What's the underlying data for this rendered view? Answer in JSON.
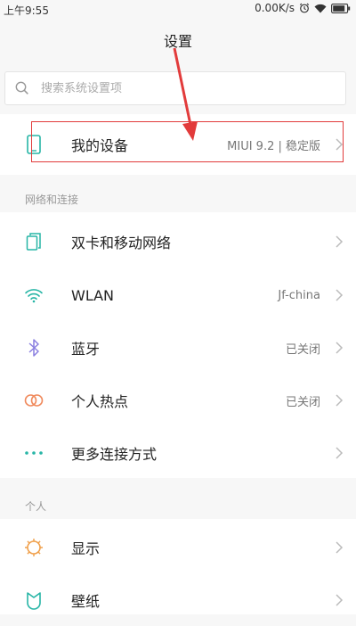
{
  "status": {
    "time": "上午9:55",
    "network_speed": "0.00K/s",
    "icons": [
      "alarm-icon",
      "wifi-icon",
      "battery-icon"
    ]
  },
  "header": {
    "title": "设置"
  },
  "search": {
    "placeholder": "搜索系统设置项"
  },
  "device": {
    "label": "我的设备",
    "value": "MIUI 9.2 | 稳定版"
  },
  "network_section": {
    "title": "网络和连接",
    "items": [
      {
        "label": "双卡和移动网络",
        "value": ""
      },
      {
        "label": "WLAN",
        "value": "Jf-china"
      },
      {
        "label": "蓝牙",
        "value": "已关闭"
      },
      {
        "label": "个人热点",
        "value": "已关闭"
      },
      {
        "label": "更多连接方式",
        "value": ""
      }
    ]
  },
  "personal_section": {
    "title": "个人",
    "items": [
      {
        "label": "显示",
        "value": ""
      },
      {
        "label": "壁纸",
        "value": ""
      }
    ]
  },
  "colors": {
    "accent_teal": "#27b5a6",
    "highlight_red": "#e23b3b",
    "bluetooth_purple": "#8a7fe0",
    "hotspot_orange": "#f08a5d",
    "display_orange": "#f0a04b"
  }
}
